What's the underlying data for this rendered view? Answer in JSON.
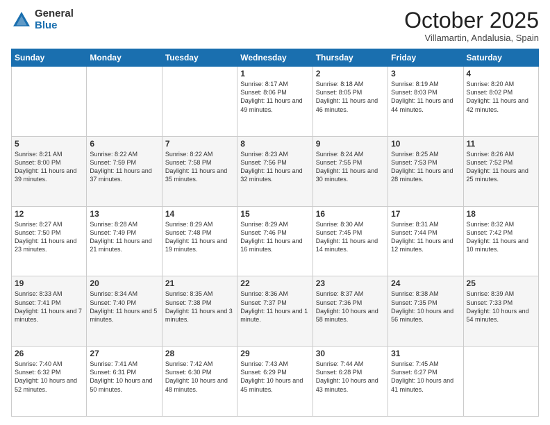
{
  "logo": {
    "general": "General",
    "blue": "Blue"
  },
  "header": {
    "month": "October 2025",
    "location": "Villamartin, Andalusia, Spain"
  },
  "weekdays": [
    "Sunday",
    "Monday",
    "Tuesday",
    "Wednesday",
    "Thursday",
    "Friday",
    "Saturday"
  ],
  "weeks": [
    [
      {
        "day": "",
        "info": ""
      },
      {
        "day": "",
        "info": ""
      },
      {
        "day": "",
        "info": ""
      },
      {
        "day": "1",
        "info": "Sunrise: 8:17 AM\nSunset: 8:06 PM\nDaylight: 11 hours\nand 49 minutes."
      },
      {
        "day": "2",
        "info": "Sunrise: 8:18 AM\nSunset: 8:05 PM\nDaylight: 11 hours\nand 46 minutes."
      },
      {
        "day": "3",
        "info": "Sunrise: 8:19 AM\nSunset: 8:03 PM\nDaylight: 11 hours\nand 44 minutes."
      },
      {
        "day": "4",
        "info": "Sunrise: 8:20 AM\nSunset: 8:02 PM\nDaylight: 11 hours\nand 42 minutes."
      }
    ],
    [
      {
        "day": "5",
        "info": "Sunrise: 8:21 AM\nSunset: 8:00 PM\nDaylight: 11 hours\nand 39 minutes."
      },
      {
        "day": "6",
        "info": "Sunrise: 8:22 AM\nSunset: 7:59 PM\nDaylight: 11 hours\nand 37 minutes."
      },
      {
        "day": "7",
        "info": "Sunrise: 8:22 AM\nSunset: 7:58 PM\nDaylight: 11 hours\nand 35 minutes."
      },
      {
        "day": "8",
        "info": "Sunrise: 8:23 AM\nSunset: 7:56 PM\nDaylight: 11 hours\nand 32 minutes."
      },
      {
        "day": "9",
        "info": "Sunrise: 8:24 AM\nSunset: 7:55 PM\nDaylight: 11 hours\nand 30 minutes."
      },
      {
        "day": "10",
        "info": "Sunrise: 8:25 AM\nSunset: 7:53 PM\nDaylight: 11 hours\nand 28 minutes."
      },
      {
        "day": "11",
        "info": "Sunrise: 8:26 AM\nSunset: 7:52 PM\nDaylight: 11 hours\nand 25 minutes."
      }
    ],
    [
      {
        "day": "12",
        "info": "Sunrise: 8:27 AM\nSunset: 7:50 PM\nDaylight: 11 hours\nand 23 minutes."
      },
      {
        "day": "13",
        "info": "Sunrise: 8:28 AM\nSunset: 7:49 PM\nDaylight: 11 hours\nand 21 minutes."
      },
      {
        "day": "14",
        "info": "Sunrise: 8:29 AM\nSunset: 7:48 PM\nDaylight: 11 hours\nand 19 minutes."
      },
      {
        "day": "15",
        "info": "Sunrise: 8:29 AM\nSunset: 7:46 PM\nDaylight: 11 hours\nand 16 minutes."
      },
      {
        "day": "16",
        "info": "Sunrise: 8:30 AM\nSunset: 7:45 PM\nDaylight: 11 hours\nand 14 minutes."
      },
      {
        "day": "17",
        "info": "Sunrise: 8:31 AM\nSunset: 7:44 PM\nDaylight: 11 hours\nand 12 minutes."
      },
      {
        "day": "18",
        "info": "Sunrise: 8:32 AM\nSunset: 7:42 PM\nDaylight: 11 hours\nand 10 minutes."
      }
    ],
    [
      {
        "day": "19",
        "info": "Sunrise: 8:33 AM\nSunset: 7:41 PM\nDaylight: 11 hours\nand 7 minutes."
      },
      {
        "day": "20",
        "info": "Sunrise: 8:34 AM\nSunset: 7:40 PM\nDaylight: 11 hours\nand 5 minutes."
      },
      {
        "day": "21",
        "info": "Sunrise: 8:35 AM\nSunset: 7:38 PM\nDaylight: 11 hours\nand 3 minutes."
      },
      {
        "day": "22",
        "info": "Sunrise: 8:36 AM\nSunset: 7:37 PM\nDaylight: 11 hours\nand 1 minute."
      },
      {
        "day": "23",
        "info": "Sunrise: 8:37 AM\nSunset: 7:36 PM\nDaylight: 10 hours\nand 58 minutes."
      },
      {
        "day": "24",
        "info": "Sunrise: 8:38 AM\nSunset: 7:35 PM\nDaylight: 10 hours\nand 56 minutes."
      },
      {
        "day": "25",
        "info": "Sunrise: 8:39 AM\nSunset: 7:33 PM\nDaylight: 10 hours\nand 54 minutes."
      }
    ],
    [
      {
        "day": "26",
        "info": "Sunrise: 7:40 AM\nSunset: 6:32 PM\nDaylight: 10 hours\nand 52 minutes."
      },
      {
        "day": "27",
        "info": "Sunrise: 7:41 AM\nSunset: 6:31 PM\nDaylight: 10 hours\nand 50 minutes."
      },
      {
        "day": "28",
        "info": "Sunrise: 7:42 AM\nSunset: 6:30 PM\nDaylight: 10 hours\nand 48 minutes."
      },
      {
        "day": "29",
        "info": "Sunrise: 7:43 AM\nSunset: 6:29 PM\nDaylight: 10 hours\nand 45 minutes."
      },
      {
        "day": "30",
        "info": "Sunrise: 7:44 AM\nSunset: 6:28 PM\nDaylight: 10 hours\nand 43 minutes."
      },
      {
        "day": "31",
        "info": "Sunrise: 7:45 AM\nSunset: 6:27 PM\nDaylight: 10 hours\nand 41 minutes."
      },
      {
        "day": "",
        "info": ""
      }
    ]
  ]
}
